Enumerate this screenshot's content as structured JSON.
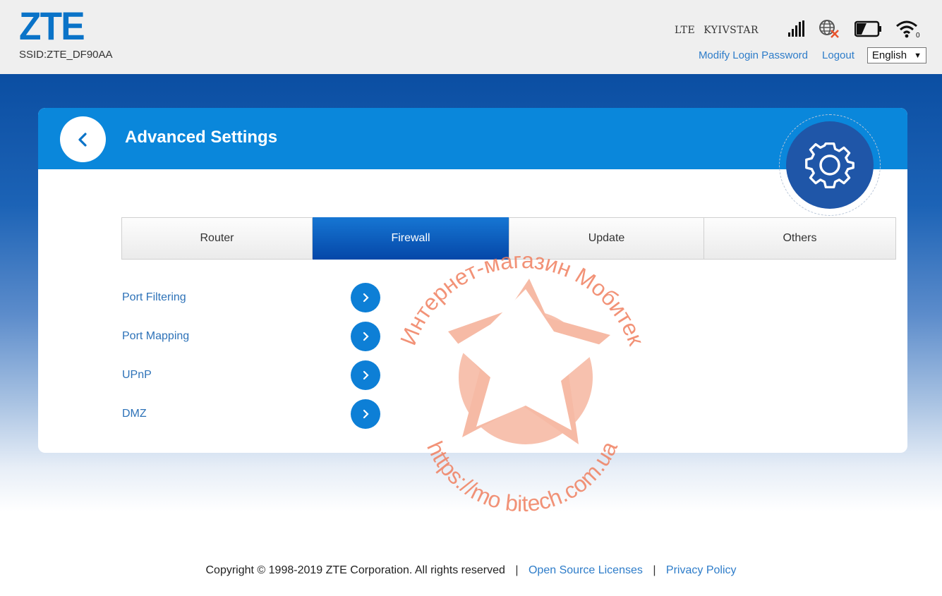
{
  "header": {
    "logo": "ZTE",
    "ssid": "SSID:ZTE_DF90AA",
    "network_type": "LTE",
    "operator": "KYIVSTAR",
    "icons": [
      "signal-bars-icon",
      "no-internet-globe-icon",
      "battery-icon",
      "wifi-icon"
    ],
    "modify_password": "Modify Login Password",
    "logout": "Logout",
    "language": "English"
  },
  "card": {
    "title": "Advanced Settings"
  },
  "tabs": [
    {
      "label": "Router",
      "active": false
    },
    {
      "label": "Firewall",
      "active": true
    },
    {
      "label": "Update",
      "active": false
    },
    {
      "label": "Others",
      "active": false
    }
  ],
  "menu": [
    {
      "label": "Port Filtering"
    },
    {
      "label": "Port Mapping"
    },
    {
      "label": "UPnP"
    },
    {
      "label": "DMZ"
    }
  ],
  "watermark": {
    "top_text": "Интернет-магазин Мобитек",
    "bottom_text": "https://mo bitech.com.ua"
  },
  "footer": {
    "copyright": "Copyright © 1998-2019 ZTE Corporation. All rights reserved",
    "open_source": "Open Source Licenses",
    "privacy": "Privacy Policy",
    "separator": "|"
  },
  "colors": {
    "brand_blue": "#0a73c8",
    "card_header": "#0a87db",
    "active_tab": "#0547a8",
    "link": "#2d7cc9",
    "watermark": "#f08060"
  }
}
